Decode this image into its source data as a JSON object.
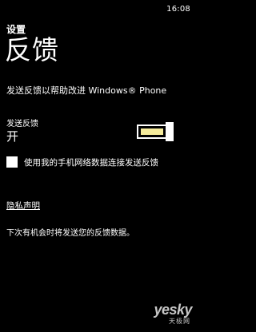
{
  "status_bar": {
    "time": "16:08"
  },
  "header": {
    "app_title": "设置",
    "page_title": "反馈"
  },
  "main": {
    "description": "发送反馈以帮助改进 Windows® Phone",
    "feedback_setting": {
      "label": "发送反馈",
      "value": "开",
      "toggle_on": true,
      "accent_color": "#f5eb9b"
    },
    "cellular_checkbox": {
      "label": "使用我的手机网络数据连接发送反馈",
      "checked": false
    },
    "privacy_link": "隐私声明",
    "footer_note": "下次有机会时将发送您的反馈数据。"
  },
  "watermark": {
    "logo": "yesky",
    "subtitle": "天极网"
  }
}
